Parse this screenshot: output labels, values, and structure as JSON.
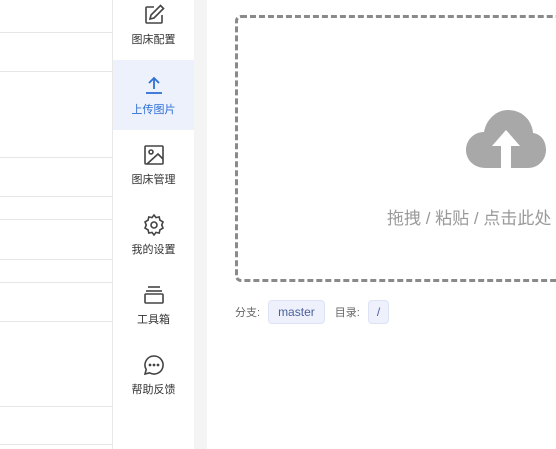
{
  "nav": {
    "items": [
      {
        "label": "图床配置",
        "icon": "edit-icon"
      },
      {
        "label": "上传图片",
        "icon": "upload-icon",
        "active": true
      },
      {
        "label": "图床管理",
        "icon": "image-icon"
      },
      {
        "label": "我的设置",
        "icon": "gear-icon"
      },
      {
        "label": "工具箱",
        "icon": "toolbox-icon"
      },
      {
        "label": "帮助反馈",
        "icon": "chat-icon"
      }
    ]
  },
  "upload": {
    "drop_text": "拖拽 / 粘贴 / 点击此处",
    "branch_label": "分支:",
    "branch_value": "master",
    "dir_label": "目录:",
    "dir_value": "/"
  },
  "colors": {
    "accent": "#2f6fd6",
    "active_bg": "#ecf1fb",
    "cloud": "#a8a8a8"
  }
}
